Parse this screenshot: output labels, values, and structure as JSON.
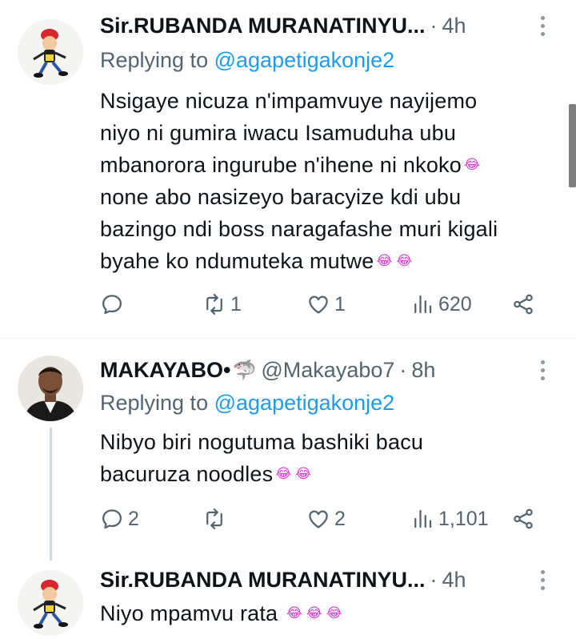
{
  "tweets": [
    {
      "author": "Sir.RUBANDA MURANATINYU...",
      "time": "4h",
      "replying_prefix": "Replying to",
      "replying_to": "@agapetigakonje2",
      "lines": [
        "Nsigaye nicuza n'impamvuye nayijemo",
        "niyo ni gumira iwacu Isamuduha ubu",
        "mbanorora ingurube n'ihene ni nkoko",
        "none abo nasizeyo baracyize kdi ubu",
        "bazingo ndi boss naragafashe muri kigali",
        "byahe ko ndumuteka mutwe"
      ],
      "emoji": "😂",
      "replies": "",
      "retweets": "1",
      "likes": "1",
      "views": "620"
    },
    {
      "author": "MAKAYABO•",
      "author_emoji": "🦈",
      "handle": "@Makayabo7",
      "time": "8h",
      "replying_prefix": "Replying to",
      "replying_to": "@agapetigakonje2",
      "lines": [
        "Nibyo biri nogutuma bashiki bacu",
        "bacuruza noodles"
      ],
      "emoji": "😂",
      "replies": "2",
      "retweets": "",
      "likes": "2",
      "views": "1,101"
    },
    {
      "author": "Sir.RUBANDA MURANATINYU...",
      "time": "4h",
      "lines": [
        "Niyo mpamvu rata"
      ],
      "emoji": "😂"
    }
  ],
  "icons": {
    "reply": "reply-icon",
    "retweet": "retweet-icon",
    "like": "heart-icon",
    "views": "views-icon",
    "share": "share-icon",
    "more": "more-icon"
  },
  "colors": {
    "text": "#0f1419",
    "muted": "#536471",
    "link": "#1d9bf0",
    "emoji_tint": "#e03bd8"
  }
}
